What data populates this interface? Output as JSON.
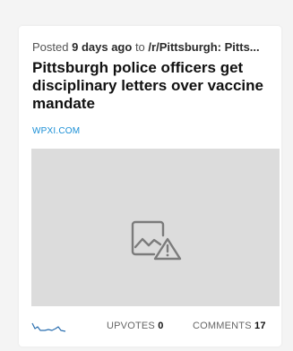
{
  "post": {
    "meta_prefix": "Posted",
    "age": "9 days ago",
    "meta_to": "to",
    "subreddit": "/r/Pittsburgh: Pitts...",
    "title": "Pittsburgh police officers get disciplinary letters over vaccine mandate",
    "domain": "WPXI.COM",
    "thumbnail_icon": "broken-image-warning-icon"
  },
  "footer": {
    "upvotes_label": "UPVOTES",
    "upvotes_count": "0",
    "comments_label": "COMMENTS",
    "comments_count": "17",
    "sparkline_color": "#2a6fb0"
  },
  "colors": {
    "domain_link": "#1a8fd6",
    "thumb_bg": "#dcdcdc"
  }
}
